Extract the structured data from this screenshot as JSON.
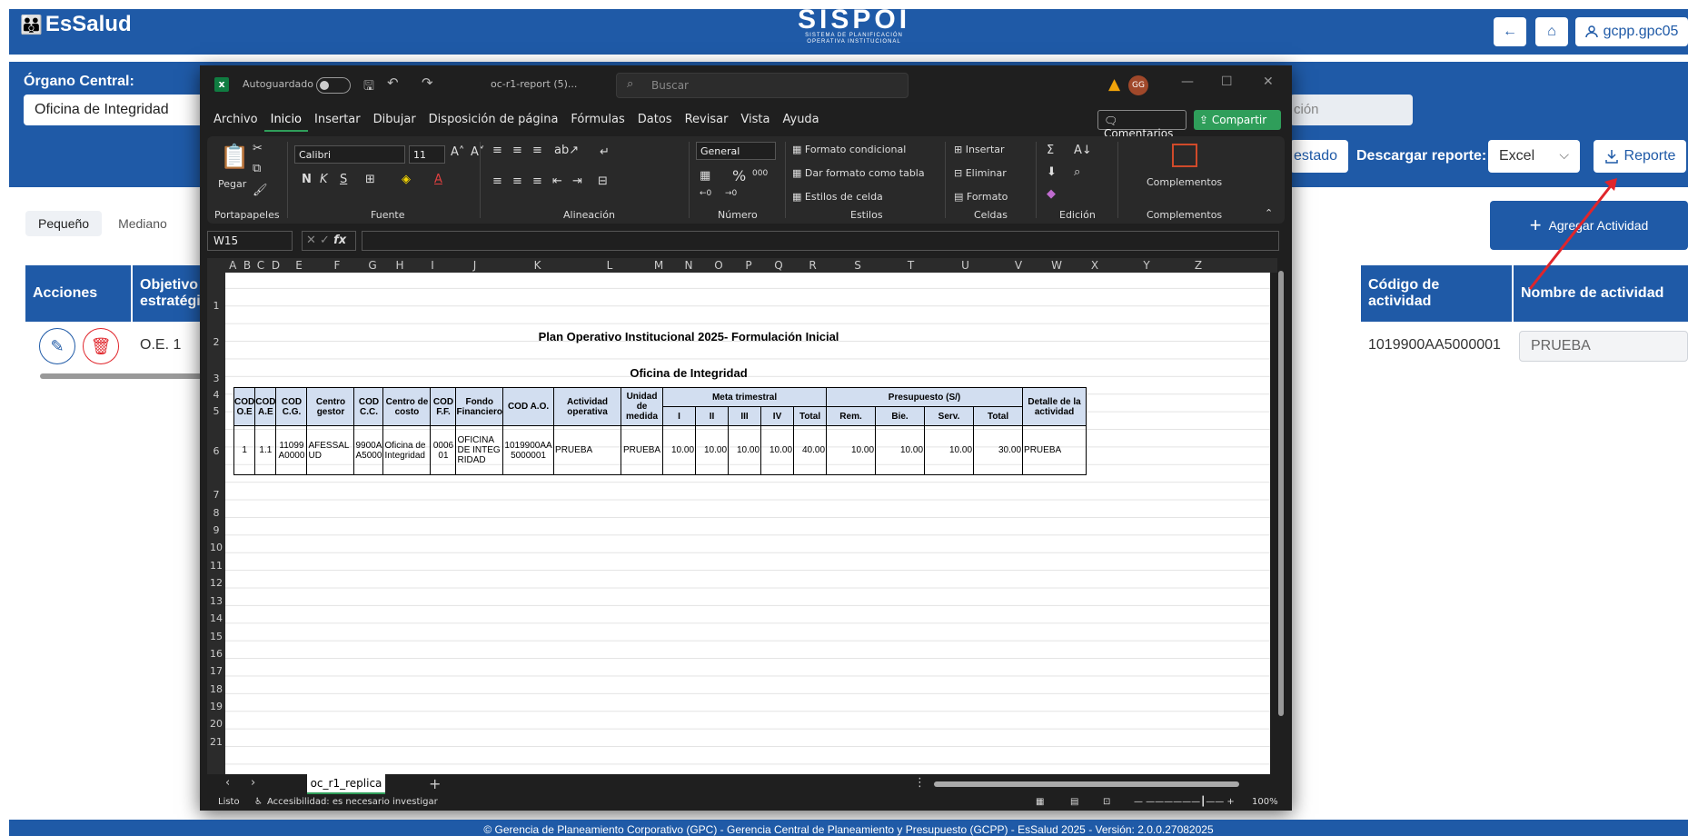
{
  "app": {
    "brand": "EsSalud",
    "logo_title": "SISPOI",
    "logo_subtitle1": "SISTEMA DE PLANIFICACIÓN",
    "logo_subtitle2": "OPERATIVA INSTITUCIONAL",
    "back_icon": "←",
    "home_icon": "⌂",
    "user_label": "gcpp.gpc05",
    "organo_label": "Órgano Central:",
    "organo_value": "Oficina de Integridad",
    "field2_value": "ción",
    "estado_label": "estado",
    "descargar_label": "Descargar reporte:",
    "format_value": "Excel",
    "reporte_label": "Reporte",
    "size_tabs": [
      "Pequeño",
      "Mediano"
    ],
    "agregar_label": "Agregar Actividad",
    "table_headers": {
      "acciones": "Acciones",
      "objetivo1": "Objetivo",
      "objetivo2": "estratégic",
      "codigo": "Código de actividad",
      "nombre": "Nombre de actividad"
    },
    "row": {
      "objetivo": "O.E. 1",
      "codigo": "1019900AA5000001",
      "nombre": "PRUEBA"
    },
    "footer": "© Gerencia de Planeamiento Corporativo (GPC) - Gerencia Central de Planeamiento y Presupuesto (GCPP) - EsSalud 2025 - Versión: 2.0.0.27082025"
  },
  "excel": {
    "autosave": "Autoguardado",
    "filename": "oc-r1-report (5)...",
    "search_placeholder": "Buscar",
    "user_initials": "GG",
    "menu": [
      "Archivo",
      "Inicio",
      "Insertar",
      "Dibujar",
      "Disposición de página",
      "Fórmulas",
      "Datos",
      "Revisar",
      "Vista",
      "Ayuda"
    ],
    "comentarios": "Comentarios",
    "compartir": "Compartir",
    "ribbon": {
      "pegar": "Pegar",
      "font": "Calibri",
      "size": "11",
      "number_format": "General",
      "formato_condicional": "Formato condicional",
      "formato_tabla": "Dar formato como tabla",
      "estilos_celda": "Estilos de celda",
      "insertar": "Insertar",
      "eliminar": "Eliminar",
      "formato": "Formato",
      "complementos": "Complementos",
      "groups": [
        "Portapapeles",
        "Fuente",
        "Alineación",
        "Número",
        "Estilos",
        "Celdas",
        "Edición",
        "Complementos"
      ]
    },
    "namebox": "W15",
    "columns": [
      "A",
      "B",
      "C",
      "D",
      "E",
      "F",
      "G",
      "H",
      "I",
      "J",
      "K",
      "L",
      "M",
      "N",
      "O",
      "P",
      "Q",
      "R",
      "S",
      "T",
      "U",
      "V",
      "W",
      "X",
      "Y",
      "Z"
    ],
    "rows": [
      "1",
      "2",
      "3",
      "4",
      "5",
      "6",
      "7",
      "8",
      "9",
      "10",
      "11",
      "12",
      "13",
      "14",
      "15",
      "16",
      "17",
      "18",
      "19",
      "20",
      "21"
    ],
    "sheet_tab": "oc_r1_replica",
    "status_ready": "Listo",
    "status_access": "Accesibilidad: es necesario investigar",
    "zoom": "100%"
  },
  "sheet": {
    "title": "Plan Operativo Institucional 2025- Formulación Inicial",
    "subtitle": "Oficina de Integridad",
    "headers": {
      "cod_oe": "COD O.E",
      "cod_ae": "COD A.E",
      "cod_cg": "COD C.G.",
      "centro_gestor": "Centro gestor",
      "cod_cc": "COD C.C.",
      "centro_costo": "Centro de costo",
      "cod_ff": "COD F.F.",
      "fondo": "Fondo Financiero",
      "cod_ao": "COD A.O.",
      "actividad": "Actividad operativa",
      "unidad": "Unidad de medida",
      "meta": "Meta trimestral",
      "presupuesto": "Presupuesto (S/)",
      "detalle": "Detalle de la actividad",
      "meta_cols": [
        "I",
        "II",
        "III",
        "IV",
        "Total"
      ],
      "pres_cols": [
        "Rem.",
        "Bie.",
        "Serv.",
        "Total"
      ]
    },
    "row": {
      "cod_oe": "1",
      "cod_ae": "1.1",
      "cod_cg": "11099A0000",
      "centro_gestor": "AFESSALUD",
      "cod_cc": "9900AA5000",
      "centro_costo": "Oficina de Integridad",
      "cod_ff": "000601",
      "fondo": "OFICINA DE INTEGRIDAD",
      "cod_ao": "1019900AA5000001",
      "actividad": "PRUEBA",
      "unidad": "PRUEBA",
      "meta": [
        "10.00",
        "10.00",
        "10.00",
        "10.00",
        "40.00"
      ],
      "pres": [
        "10.00",
        "10.00",
        "10.00",
        "30.00"
      ],
      "detalle": "PRUEBA"
    }
  },
  "colors": {
    "brand": "#1f5aa7",
    "excel_green": "#2f9e5a",
    "header_fill": "#d2def0",
    "arrow": "#e0252b"
  }
}
